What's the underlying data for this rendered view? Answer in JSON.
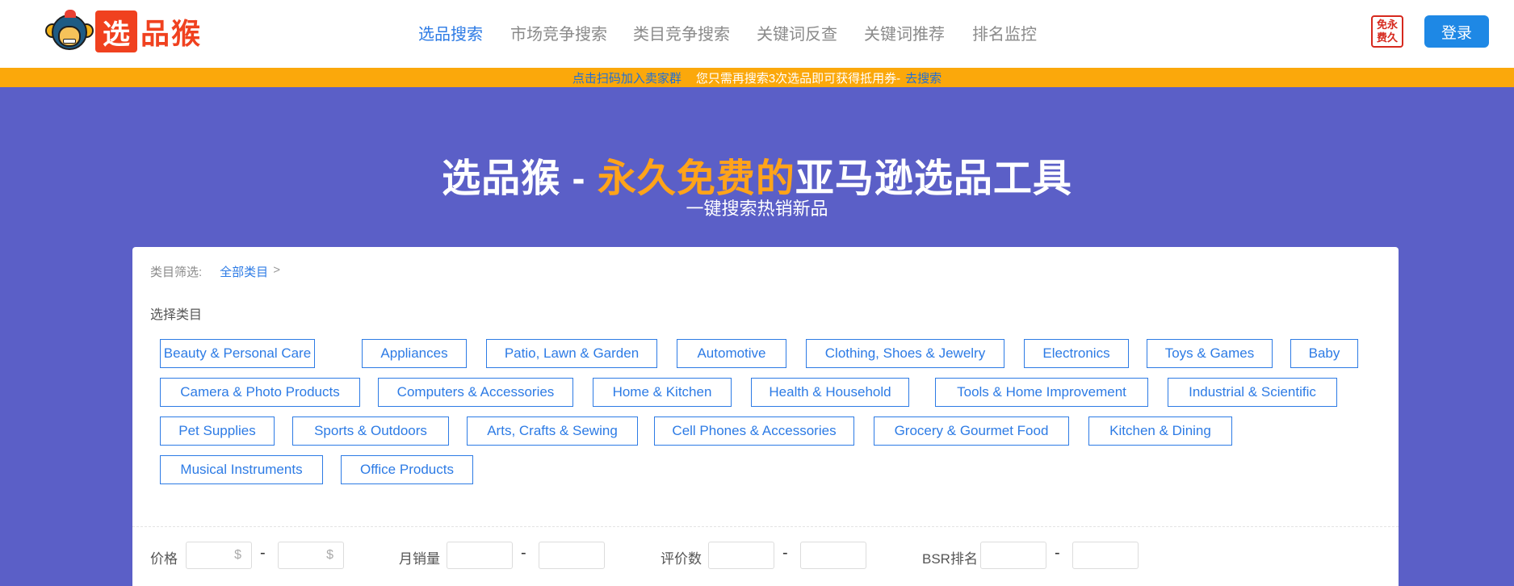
{
  "header": {
    "logo": {
      "box_char": "选",
      "rest_text": "品猴"
    },
    "nav": [
      {
        "label": "选品搜索",
        "active": true
      },
      {
        "label": "市场竞争搜索",
        "active": false
      },
      {
        "label": "类目竞争搜索",
        "active": false
      },
      {
        "label": "关键词反查",
        "active": false
      },
      {
        "label": "关键词推荐",
        "active": false
      },
      {
        "label": "排名监控",
        "active": false
      }
    ],
    "badge_text": [
      "永",
      "久",
      "免",
      "费"
    ],
    "login_label": "登录"
  },
  "notice": {
    "join_link": "点击扫码加入卖家群",
    "message": "您只需再搜索3次选品即可获得抵用券-",
    "go_link": "去搜索"
  },
  "hero": {
    "title_prefix": "选品猴 - ",
    "title_highlight": "永久免费的",
    "title_suffix": "亚马逊选品工具",
    "subtitle": "一键搜索热销新品"
  },
  "filter_panel": {
    "crumb_label": "类目筛选:",
    "crumb_all": "全部类目",
    "crumb_sep": ">",
    "section_label": "选择类目",
    "categories": [
      "Beauty & Personal Care",
      "Appliances",
      "Patio, Lawn & Garden",
      "Automotive",
      "Clothing, Shoes & Jewelry",
      "Electronics",
      "Toys & Games",
      "Baby",
      "Camera & Photo Products",
      "Computers & Accessories",
      "Home & Kitchen",
      "Health & Household",
      "Tools & Home Improvement",
      "Industrial & Scientific",
      "Pet Supplies",
      "Sports & Outdoors",
      "Arts, Crafts & Sewing",
      "Cell Phones & Accessories",
      "Grocery & Gourmet Food",
      "Kitchen & Dining",
      "Musical Instruments",
      "Office Products"
    ],
    "filters": {
      "price": {
        "label": "价格",
        "min_placeholder": "$",
        "max_placeholder": "$"
      },
      "monthly_sales": {
        "label": "月销量",
        "min_placeholder": "",
        "max_placeholder": ""
      },
      "reviews": {
        "label": "评价数",
        "min_placeholder": "",
        "max_placeholder": ""
      },
      "bsr": {
        "label": "BSR排名",
        "min_placeholder": "",
        "max_placeholder": ""
      },
      "range_sep": "-"
    }
  },
  "colors": {
    "accent": "#2d7be5",
    "brand_red": "#f0411f",
    "notice_bg": "#fba80b",
    "hero_bg": "#5b5fc7",
    "highlight": "#ffa31a"
  }
}
